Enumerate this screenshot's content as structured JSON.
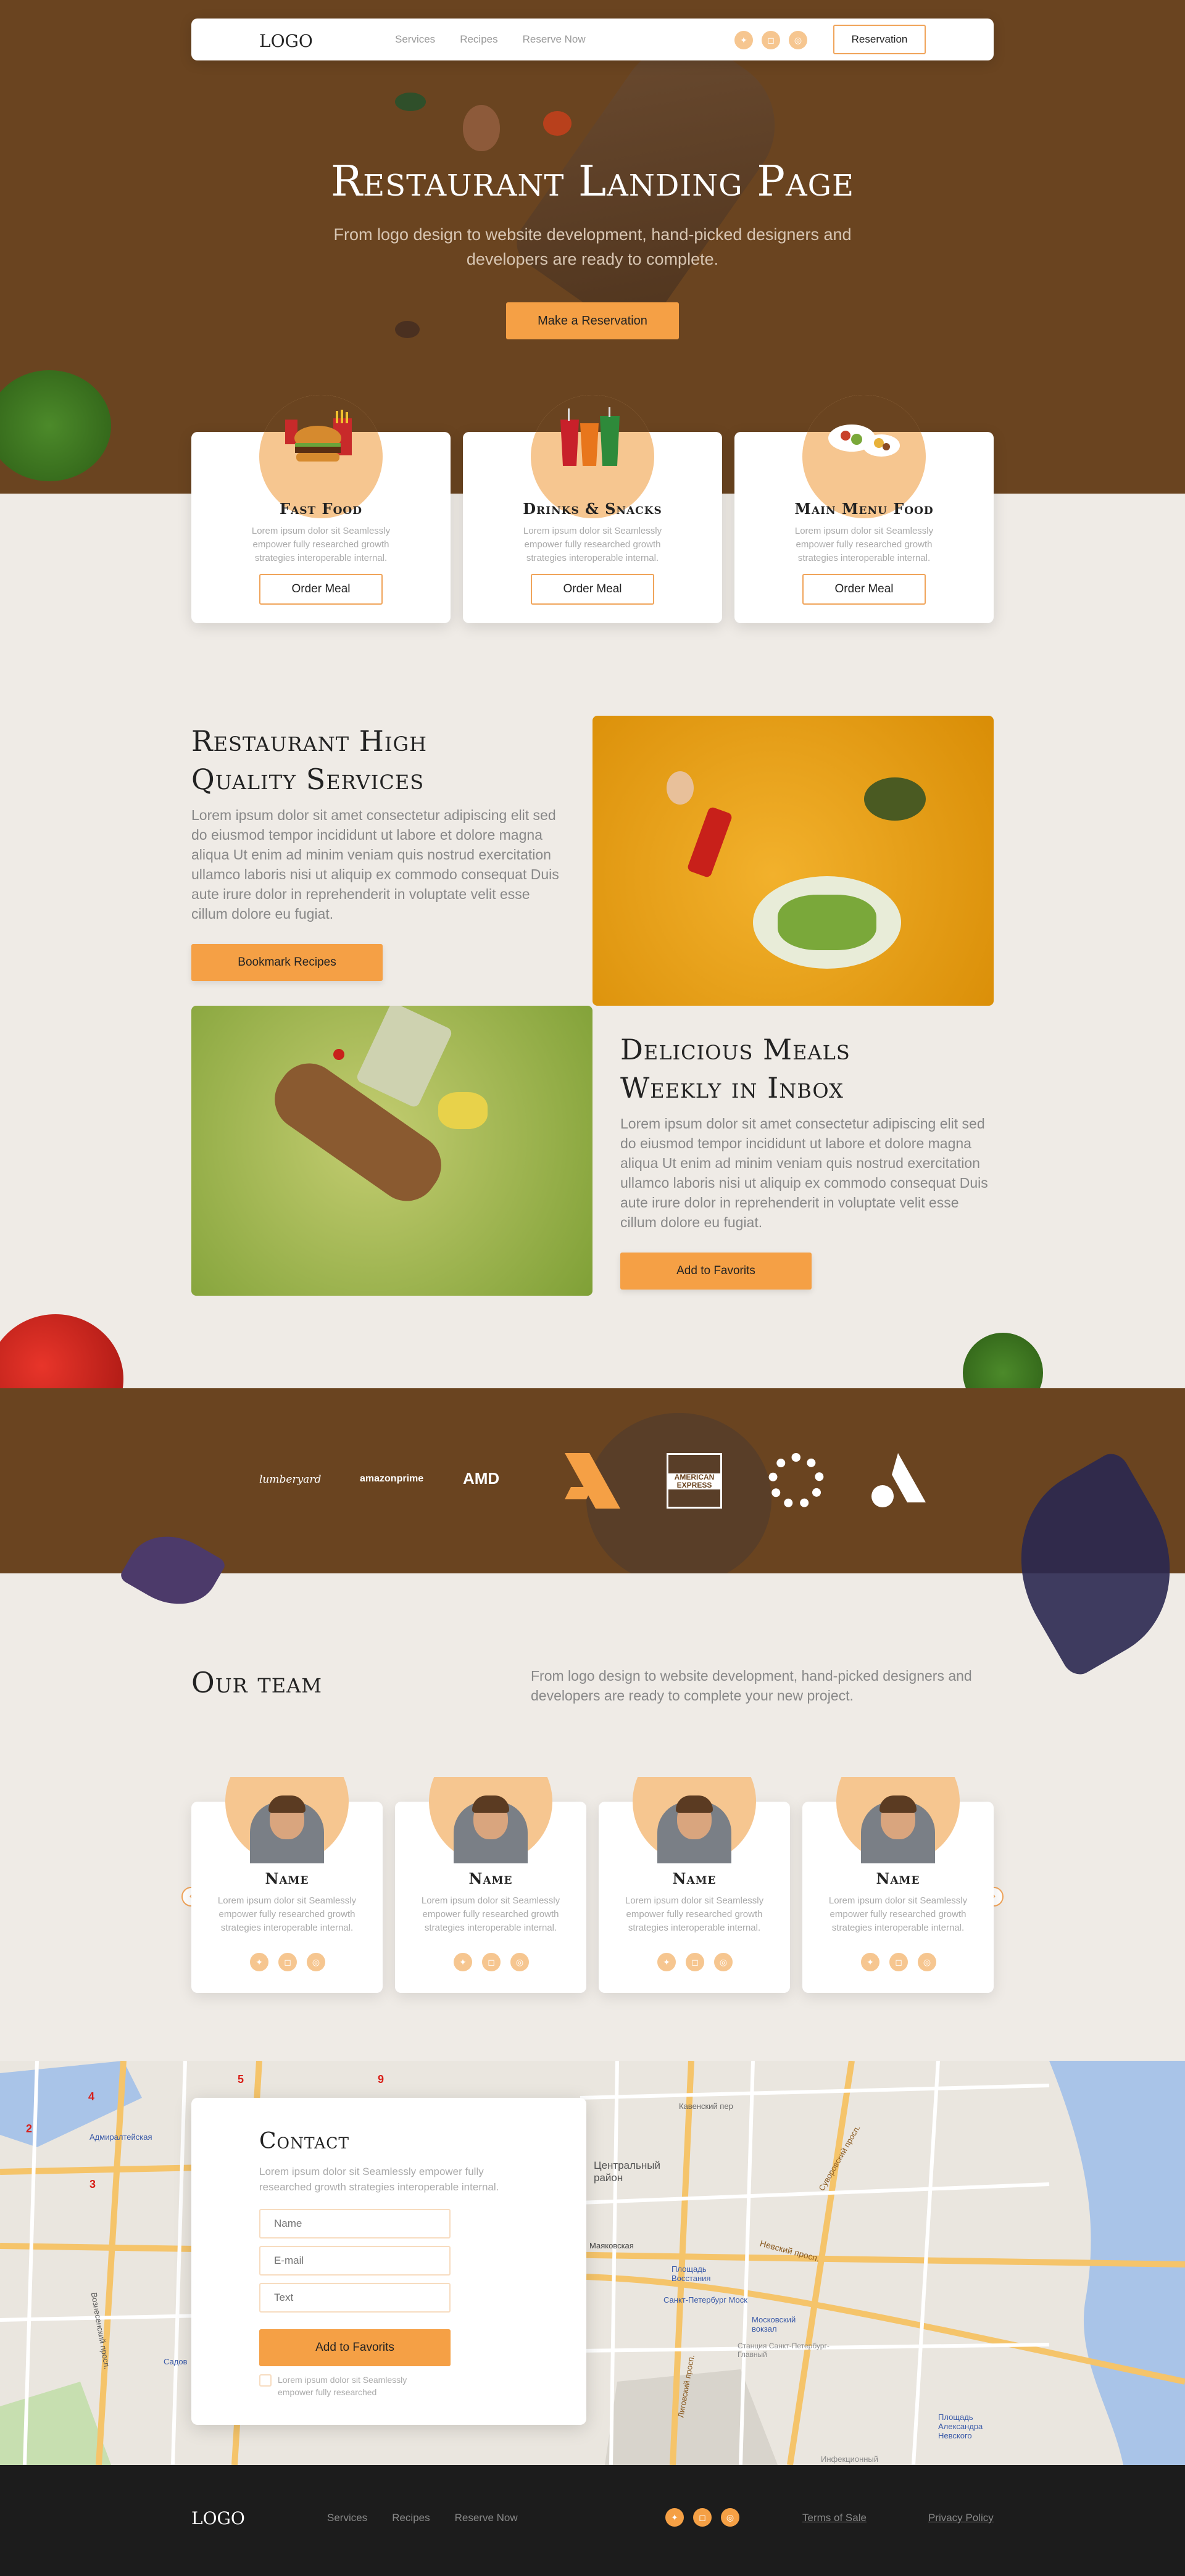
{
  "nav": {
    "logo": "LOGO",
    "links": [
      "Services",
      "Recipes",
      "Reserve Now"
    ],
    "social_icons": [
      "twitter-icon",
      "instagram-icon",
      "dribbble-icon"
    ],
    "reservation_label": "Reservation"
  },
  "hero": {
    "title": "Restaurant Landing Page",
    "subtitle": "From logo design to website development, hand-picked designers and developers are ready to complete.",
    "cta_label": "Make a Reservation"
  },
  "categories": [
    {
      "title": "Fast Food",
      "text": "Lorem ipsum dolor sit Seamlessly empower fully researched growth strategies interoperable internal.",
      "button": "Order Meal",
      "icon": "burger-fries-icon"
    },
    {
      "title": "Drinks & Snacks",
      "text": "Lorem ipsum dolor sit Seamlessly empower fully researched growth strategies interoperable internal.",
      "button": "Order Meal",
      "icon": "soda-cups-icon"
    },
    {
      "title": "Main Menu Food",
      "text": "Lorem ipsum dolor sit Seamlessly empower fully researched growth strategies interoperable internal.",
      "button": "Order Meal",
      "icon": "dinner-plates-icon"
    }
  ],
  "features": [
    {
      "title_line1": "Restaurant High",
      "title_line2": "Quality Services",
      "text": "Lorem ipsum dolor sit amet consectetur adipiscing elit sed do eiusmod tempor incididunt ut labore et dolore magna aliqua Ut enim ad minim veniam quis nostrud exercitation ullamco laboris nisi ut aliquip ex commodo consequat Duis aute irure dolor in reprehenderit in voluptate velit esse cillum dolore eu fugiat.",
      "button": "Bookmark Recipes"
    },
    {
      "title_line1": "Delicious Meals",
      "title_line2": "Weekly in Inbox",
      "text": "Lorem ipsum dolor sit amet consectetur adipiscing elit sed do eiusmod tempor incididunt ut labore et dolore magna aliqua Ut enim ad minim veniam quis nostrud exercitation ullamco laboris nisi ut aliquip ex commodo consequat Duis aute irure dolor in reprehenderit in voluptate velit esse cillum dolore eu fugiat.",
      "button": "Add to Favorits"
    }
  ],
  "brands": [
    "lumberyard",
    "amazon prime",
    "AMD",
    "american-express-logo",
    "ring-logo",
    "a-logo",
    "arrow-logo"
  ],
  "brand_texts": {
    "lumberyard": "lumberyard",
    "amazon": "amazonprime",
    "amd": "AMD",
    "amex": "AMERICAN EXPRESS"
  },
  "team": {
    "title": "Our team",
    "subtitle": "From logo design to website development, hand-picked designers and developers are ready to complete your new project.",
    "members": [
      {
        "name": "Name",
        "text": "Lorem ipsum dolor sit Seamlessly empower fully researched growth strategies interoperable internal."
      },
      {
        "name": "Name",
        "text": "Lorem ipsum dolor sit Seamlessly empower fully researched growth strategies interoperable internal."
      },
      {
        "name": "Name",
        "text": "Lorem ipsum dolor sit Seamlessly empower fully researched growth strategies interoperable internal."
      },
      {
        "name": "Name",
        "text": "Lorem ipsum dolor sit Seamlessly empower fully researched growth strategies interoperable internal."
      }
    ],
    "prev_icon": "chevron-left-icon",
    "next_icon": "chevron-right-icon"
  },
  "map": {
    "labels": [
      "Кавенский пер",
      "Центральный район",
      "Маяковская",
      "Невский просп.",
      "Площадь Восстания",
      "Санкт-Петербург Моск",
      "Московский вокзал",
      "Станция Санкт-Петербург-Главный",
      "Суворовский просп.",
      "Площадь Александра Невского",
      "Лиговский просп.",
      "Адмиралтейская",
      "Вознесенский просп.",
      "Садов",
      "Инфекционный"
    ],
    "markers": [
      "2",
      "3",
      "4",
      "5",
      "9"
    ]
  },
  "contact": {
    "title": "Contact",
    "desc": "Lorem ipsum dolor sit Seamlessly empower fully researched growth strategies interoperable internal.",
    "name_placeholder": "Name",
    "email_placeholder": "E-mail",
    "text_placeholder": "Text",
    "submit_label": "Add to Favorits",
    "agree_text": "Lorem ipsum dolor sit Seamlessly empower fully researched"
  },
  "footer": {
    "logo": "LOGO",
    "links": [
      "Services",
      "Recipes",
      "Reserve Now"
    ],
    "terms": "Terms of Sale",
    "privacy": "Privacy Policy"
  },
  "colors": {
    "brown": "#6a4420",
    "accent": "#f5a045",
    "peach": "#f6c690",
    "page_bg": "#efebe6",
    "footer": "#1c1c1c"
  }
}
